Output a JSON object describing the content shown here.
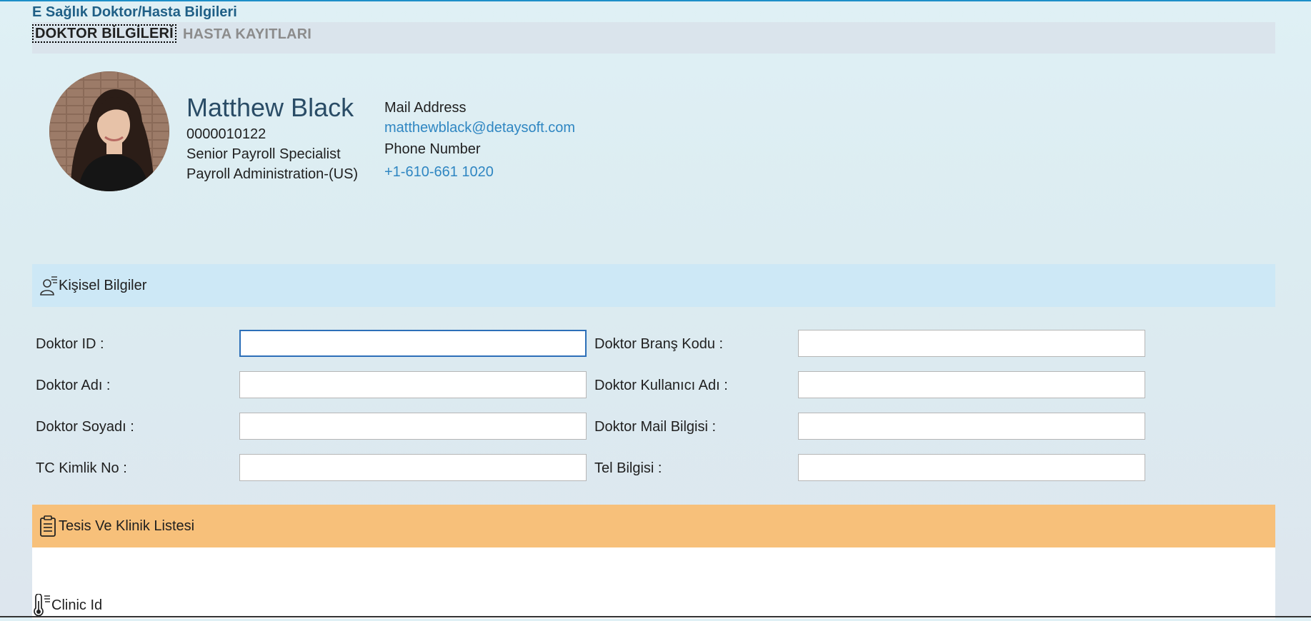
{
  "app": {
    "title": "E Sağlık Doktor/Hasta Bilgileri"
  },
  "tabs": [
    {
      "label": "DOKTOR BİLGİLERİ",
      "active": true
    },
    {
      "label": "HASTA KAYITLARI",
      "active": false
    }
  ],
  "profile": {
    "name": "Matthew Black",
    "id": "0000010122",
    "title": "Senior Payroll Specialist",
    "department": "Payroll Administration-(US)",
    "mail_label": "Mail Address",
    "mail": "matthewblack@detaysoft.com",
    "phone_label": "Phone Number",
    "phone": "+1-610-661 1020"
  },
  "personal_section": {
    "title": "Kişisel Bilgiler",
    "icon": "user-list-icon",
    "fields": [
      {
        "label": "Doktor ID :",
        "value": ""
      },
      {
        "label": "Doktor Branş Kodu :",
        "value": ""
      },
      {
        "label": "Doktor Adı :",
        "value": ""
      },
      {
        "label": "Doktor Kullanıcı Adı :",
        "value": ""
      },
      {
        "label": "Doktor Soyadı :",
        "value": ""
      },
      {
        "label": "Doktor Mail Bilgisi :",
        "value": ""
      },
      {
        "label": "TC Kimlik No :",
        "value": ""
      },
      {
        "label": "Tel Bilgisi :",
        "value": ""
      }
    ]
  },
  "clinic_section": {
    "title": "Tesis Ve Klinik Listesi",
    "icon": "clipboard-icon",
    "column_header": "Clinic Id",
    "column_icon": "thermometer-icon"
  },
  "colors": {
    "accent": "#1d8fc8",
    "link": "#2f86c2",
    "section_blue": "#cde8f6",
    "section_orange": "#f7c07a"
  }
}
